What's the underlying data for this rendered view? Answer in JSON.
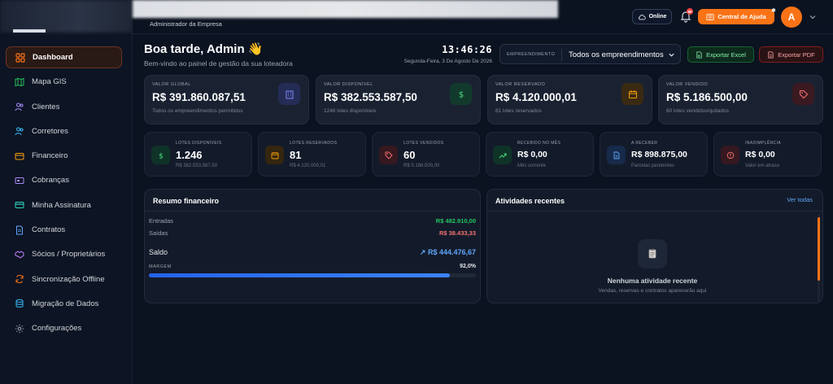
{
  "colors": {
    "accent": "#f97316",
    "green": "#22c55e",
    "red": "#f87171",
    "blue": "#60a5fa"
  },
  "sidebar": {
    "items": [
      {
        "label": "Dashboard",
        "icon": "dashboard-icon",
        "active": true
      },
      {
        "label": "Mapa GIS",
        "icon": "map-icon"
      },
      {
        "label": "Clientes",
        "icon": "users-icon"
      },
      {
        "label": "Corretores",
        "icon": "user-group-icon"
      },
      {
        "label": "Financeiro",
        "icon": "wallet-icon"
      },
      {
        "label": "Cobranças",
        "icon": "card-icon"
      },
      {
        "label": "Minha Assinatura",
        "icon": "credit-card-icon"
      },
      {
        "label": "Contratos",
        "icon": "document-icon"
      },
      {
        "label": "Sócios / Proprietários",
        "icon": "handshake-icon"
      },
      {
        "label": "Sincronização Offline",
        "icon": "sync-icon"
      },
      {
        "label": "Migração de Dados",
        "icon": "database-icon"
      },
      {
        "label": "Configurações",
        "icon": "gear-icon"
      }
    ]
  },
  "topbar": {
    "subtitle": "Administrador da Empresa",
    "online_label": "Online",
    "notification_count": "99",
    "help_label": "Central de Ajuda",
    "help_star": "✱",
    "avatar_initial": "A"
  },
  "header": {
    "greeting": "Boa tarde, Admin 👋",
    "subtitle": "Bem-vindo ao painel de gestão da sua loteadora",
    "clock": "13:46:26",
    "date": "Segunda-Feira, 3 De Agosto De 2026",
    "empreendimento_label": "EMPREENDIMENTO",
    "empreendimento_value": "Todos os empreendimentos",
    "export_excel": "Exportar Excel",
    "export_pdf": "Exportar PDF"
  },
  "big_cards": [
    {
      "label": "VALOR GLOBAL",
      "value": "R$ 391.860.087,51",
      "sub": "Todos os empreendimentos permitidos",
      "icon": "building-icon"
    },
    {
      "label": "VALOR DISPONÍVEL",
      "value": "R$ 382.553.587,50",
      "sub": "1246 lotes disponíveis",
      "icon": "dollar-icon"
    },
    {
      "label": "VALOR RESERVADO",
      "value": "R$ 4.120.000,01",
      "sub": "81 lotes reservados",
      "icon": "calendar-icon"
    },
    {
      "label": "VALOR VENDIDO",
      "value": "R$ 5.186.500,00",
      "sub": "60 lotes vendidos/quitados",
      "icon": "tag-icon"
    }
  ],
  "small_cards": [
    {
      "label": "LOTES DISPONÍVEIS",
      "value": "1.246",
      "sub": "R$ 382.553.587,50",
      "icon": "dollar-icon"
    },
    {
      "label": "LOTES RESERVADOS",
      "value": "81",
      "sub": "R$ 4.120.000,01",
      "icon": "calendar-icon"
    },
    {
      "label": "LOTES VENDIDOS",
      "value": "60",
      "sub": "R$ 5.186.500,00",
      "icon": "tag-icon"
    },
    {
      "label": "RECEBIDO NO MÊS",
      "value": "R$ 0,00",
      "sub": "Mês corrente",
      "icon": "trend-up-icon"
    },
    {
      "label": "A RECEBER",
      "value": "R$ 898.875,00",
      "sub": "Parcelas pendentes",
      "icon": "document-icon"
    },
    {
      "label": "INADIMPLÊNCIA",
      "value": "R$ 0,00",
      "sub": "Valor em atraso",
      "icon": "alert-icon"
    }
  ],
  "finance": {
    "title": "Resumo financeiro",
    "entradas_label": "Entradas",
    "entradas_value": "R$ 482.910,00",
    "saidas_label": "Saídas",
    "saidas_value": "R$ 38.433,33",
    "saldo_label": "Saldo",
    "saldo_value": "↗ R$ 444.476,67",
    "margem_label": "MARGEM",
    "margem_value": "92,0%",
    "margem_fraction": 0.92
  },
  "activities": {
    "title": "Atividades recentes",
    "link": "Ver todas",
    "empty_title": "Nenhuma atividade recente",
    "empty_sub": "Vendas, reservas e contratos aparecerão aqui",
    "icon": "clipboard-icon"
  }
}
